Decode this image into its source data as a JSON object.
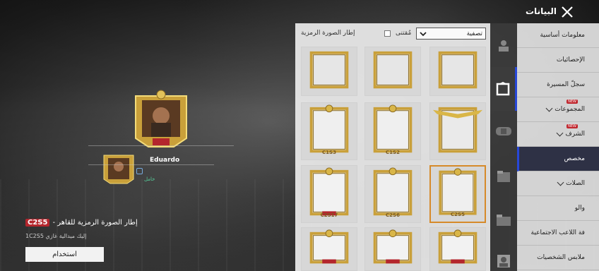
{
  "header": {
    "title": "البيانات"
  },
  "preview": {
    "player_name": "Eduardo",
    "status": "خامل",
    "item_tag": "C2S5",
    "item_title": "إطار الصورة الرمزية للقاهر -",
    "item_desc": "إليك ميدالية غازي 1C2S5",
    "use_label": "استخدام"
  },
  "panel": {
    "title": "إطار الصورة الرمزية",
    "owned_label": "مُقتنى",
    "filter_label": "تصفية",
    "frames": [
      {
        "tag": "",
        "style": "plain"
      },
      {
        "tag": "",
        "style": "plain"
      },
      {
        "tag": "",
        "style": "plain"
      },
      {
        "tag": "",
        "style": "winged"
      },
      {
        "tag": "C1S2",
        "style": "crown"
      },
      {
        "tag": "C1S3",
        "style": "crown"
      },
      {
        "tag": "C2S5",
        "style": "crown",
        "selected": true
      },
      {
        "tag": "C2S6",
        "style": "crown"
      },
      {
        "tag": "C2S17",
        "style": "ornate"
      },
      {
        "tag": "",
        "style": "ornate"
      },
      {
        "tag": "",
        "style": "ornate"
      },
      {
        "tag": "",
        "style": "ornate"
      }
    ]
  },
  "nav": {
    "items": [
      {
        "label": "معلومات أساسية",
        "chevron": false,
        "new": false
      },
      {
        "label": "الإحصائيات",
        "chevron": false,
        "new": false
      },
      {
        "label": "سجلّ المسيرة",
        "chevron": false,
        "new": false
      },
      {
        "label": "المجموعات",
        "chevron": true,
        "new": true
      },
      {
        "label": "الشرف",
        "chevron": true,
        "new": true
      },
      {
        "label": "مخصص",
        "chevron": false,
        "new": false,
        "active": true
      },
      {
        "label": "الصلات",
        "chevron": true,
        "new": false
      },
      {
        "label": "والو",
        "chevron": false,
        "new": false
      },
      {
        "label": "فة اللاعب الاجتماعية",
        "chevron": false,
        "new": false
      },
      {
        "label": "ملابس الشخصيات",
        "chevron": false,
        "new": false
      }
    ],
    "new_badge": "NEW"
  },
  "colors": {
    "accent": "#2747d8",
    "gold": "#d9b648",
    "tag_red": "#b4262d",
    "selected_border": "#d68a2a"
  }
}
